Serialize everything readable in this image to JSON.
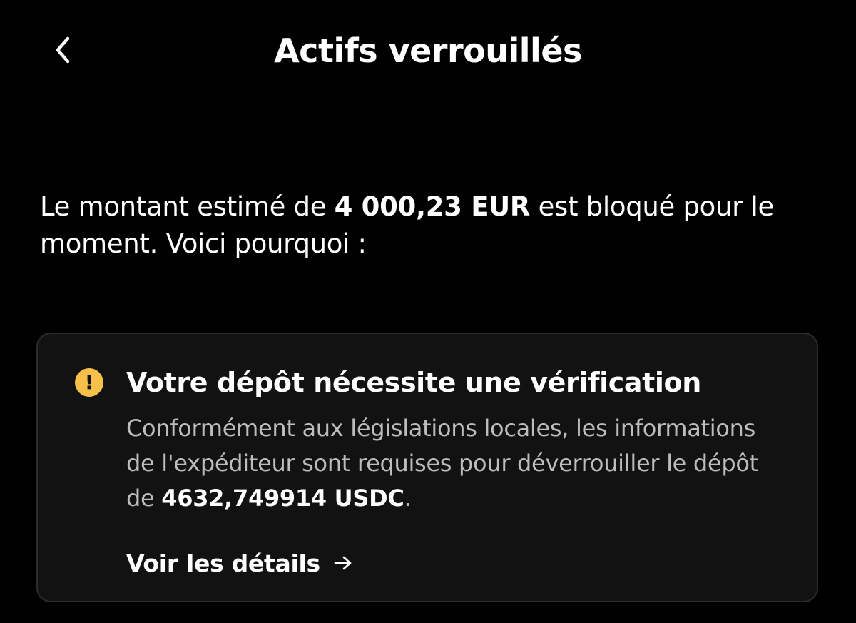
{
  "header": {
    "back_icon": "chevron-left-icon",
    "title": "Actifs verrouillés"
  },
  "intro": {
    "text_before": "Le montant estimé de ",
    "amount": "4 000,23 EUR",
    "text_after": " est bloqué pour le moment. Voici pourquoi :"
  },
  "card": {
    "icon": "warning-icon",
    "icon_glyph": "!",
    "icon_color": "#f7c04a",
    "title": "Votre dépôt nécessite une vérification",
    "body_before": "Conformément aux législations locales, les informations de l'expéditeur sont requises pour déverrouiller le dépôt de ",
    "body_amount": "4632,749914 USDC",
    "body_after": ".",
    "link_label": "Voir les détails",
    "link_icon": "arrow-right-icon"
  },
  "colors": {
    "background": "#000000",
    "card_background": "#121212",
    "card_border": "#2c2c2c",
    "secondary_text": "#bdbdbd",
    "warning": "#f7c04a"
  }
}
